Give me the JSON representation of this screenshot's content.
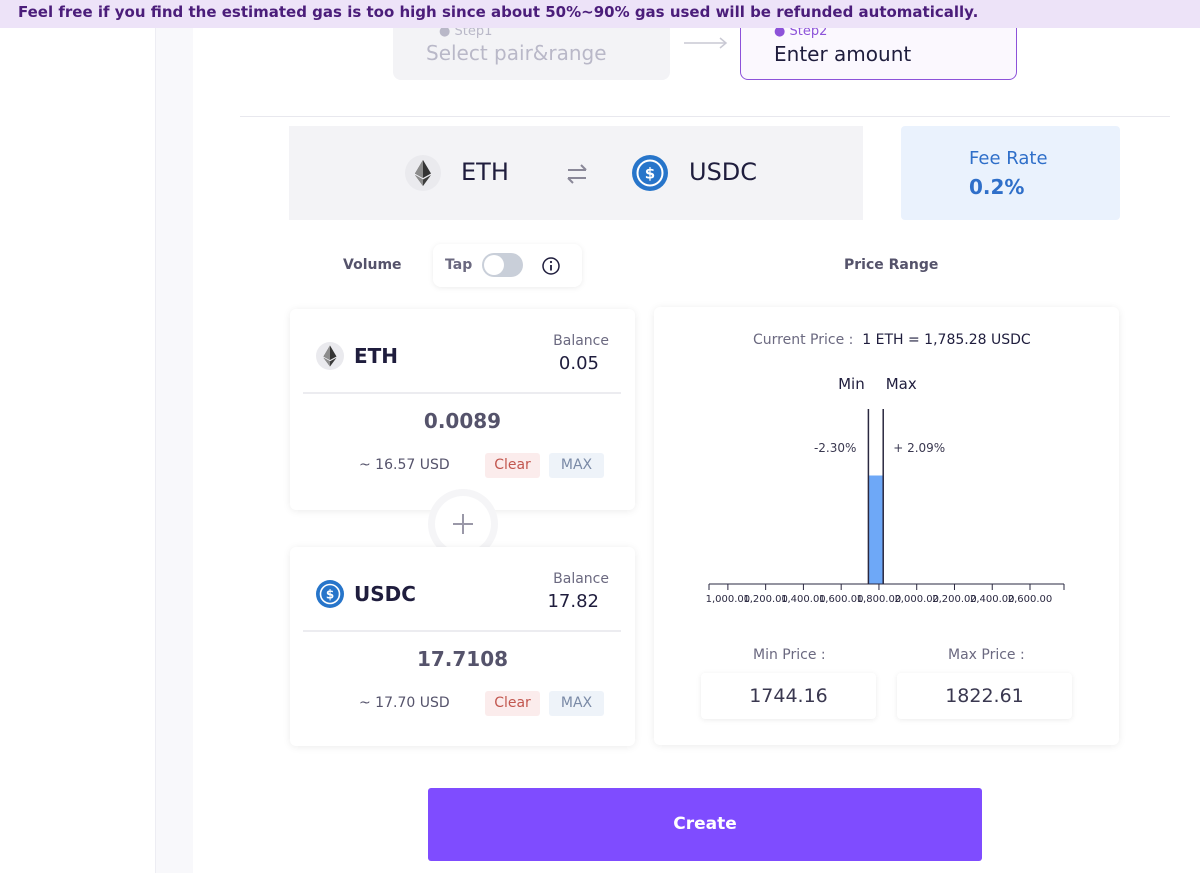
{
  "banner": {
    "text": "Feel free if you find the estimated gas is too high since about 50%~90% gas used will be refunded automatically."
  },
  "steps": [
    {
      "label": "Step1",
      "title": "Select pair&range",
      "active": false
    },
    {
      "label": "Step2",
      "title": "Enter amount",
      "active": true
    }
  ],
  "pair": {
    "token_a": {
      "symbol": "ETH",
      "icon": "eth-icon"
    },
    "token_b": {
      "symbol": "USDC",
      "icon": "usdc-icon"
    },
    "swap_icon": "swap-arrows-icon"
  },
  "fee": {
    "label": "Fee Rate",
    "value": "0.2%"
  },
  "volume": {
    "label": "Volume",
    "tap_label": "Tap",
    "tap_enabled": false,
    "info_icon": "info-icon"
  },
  "price_range": {
    "label": "Price Range",
    "current_price_label": "Current Price :",
    "current_price_value": "1 ETH = 1,785.28 USDC",
    "min_label": "Min",
    "max_label": "Max",
    "min_pct": "-2.30%",
    "max_pct": "+ 2.09%",
    "min_price_label": "Min Price :",
    "max_price_label": "Max Price :",
    "min_price": "1744.16",
    "max_price": "1822.61"
  },
  "chart_data": {
    "type": "bar",
    "x_ticks": [
      "1,000.00",
      "1,200.00",
      "1,400.00",
      "1,600.00",
      "1,800.00",
      "2,000.00",
      "2,200.00",
      "2,400.00",
      "2,600.00"
    ],
    "xlim": [
      900,
      2780
    ],
    "range_min": 1744.16,
    "range_max": 1822.61,
    "current_price": 1785.28,
    "liquidity_fill": 0.62,
    "colors": {
      "liquidity": "#6ea8f7",
      "range_line": "#2a2840"
    }
  },
  "cards": [
    {
      "symbol": "ETH",
      "icon": "eth-icon",
      "balance_label": "Balance",
      "balance": "0.05",
      "amount": "0.0089",
      "usd": "~ 16.57 USD",
      "clear_label": "Clear",
      "max_label": "MAX"
    },
    {
      "symbol": "USDC",
      "icon": "usdc-icon",
      "balance_label": "Balance",
      "balance": "17.82",
      "amount": "17.7108",
      "usd": "~ 17.70 USD",
      "clear_label": "Clear",
      "max_label": "MAX"
    }
  ],
  "plus_icon": "plus-icon",
  "create_button": {
    "label": "Create"
  },
  "colors": {
    "accent": "#7f4cff",
    "banner_bg": "#ede3f8",
    "fee_text": "#2f6fc9"
  }
}
